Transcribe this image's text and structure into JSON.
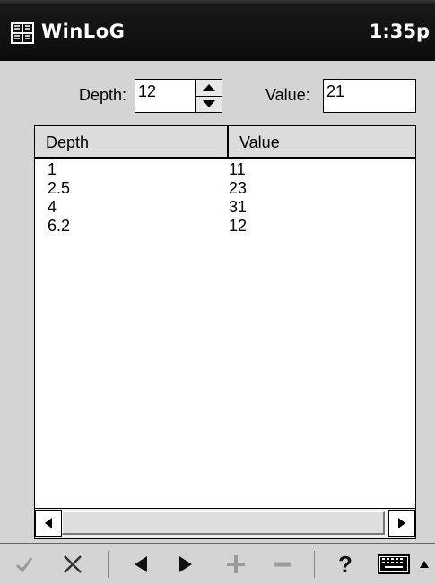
{
  "titlebar": {
    "app_title": "WinLoG",
    "clock": "1:35p",
    "start_icon": "windows-logo-icon"
  },
  "inputs": {
    "depth_label": "Depth:",
    "depth_value": "12",
    "value_label": "Value:",
    "value_value": "21"
  },
  "table": {
    "headers": [
      "Depth",
      "Value"
    ],
    "rows": [
      {
        "depth": "1",
        "value": "11"
      },
      {
        "depth": "2.5",
        "value": "23"
      },
      {
        "depth": "4",
        "value": "31"
      },
      {
        "depth": "6.2",
        "value": "12"
      }
    ]
  },
  "toolbar": {
    "items": [
      "check-icon",
      "cross-icon",
      "left-arrow-icon",
      "right-arrow-icon",
      "plus-icon",
      "minus-icon",
      "help-icon",
      "keyboard-icon",
      "sip-up-arrow-icon"
    ],
    "help_label": "?"
  },
  "colors": {
    "titlebar_bg": "#111111",
    "body_bg": "#d4d4d4",
    "list_bg": "#ffffff",
    "disabled_icon": "#9a9a9a"
  }
}
